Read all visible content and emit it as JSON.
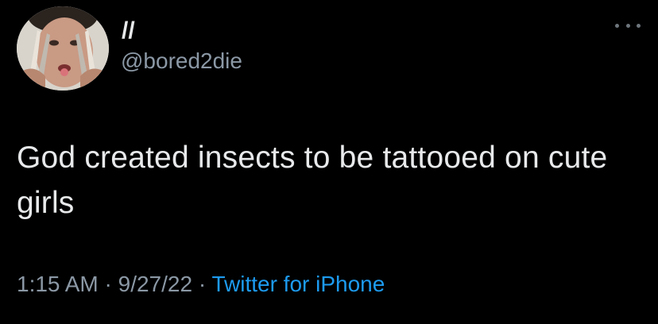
{
  "tweet": {
    "display_name": "//",
    "handle": "@bored2die",
    "text": "God created insects to be tattooed on cute girls",
    "time": "1:15 AM",
    "separator": "·",
    "date": "9/27/22",
    "source": "Twitter for iPhone"
  },
  "icons": {
    "more": "more-horizontal-icon",
    "avatar": "profile-photo"
  },
  "colors": {
    "background": "#000000",
    "text": "#e7e9ea",
    "secondary": "#8b98a5",
    "link": "#1d9bf0"
  }
}
